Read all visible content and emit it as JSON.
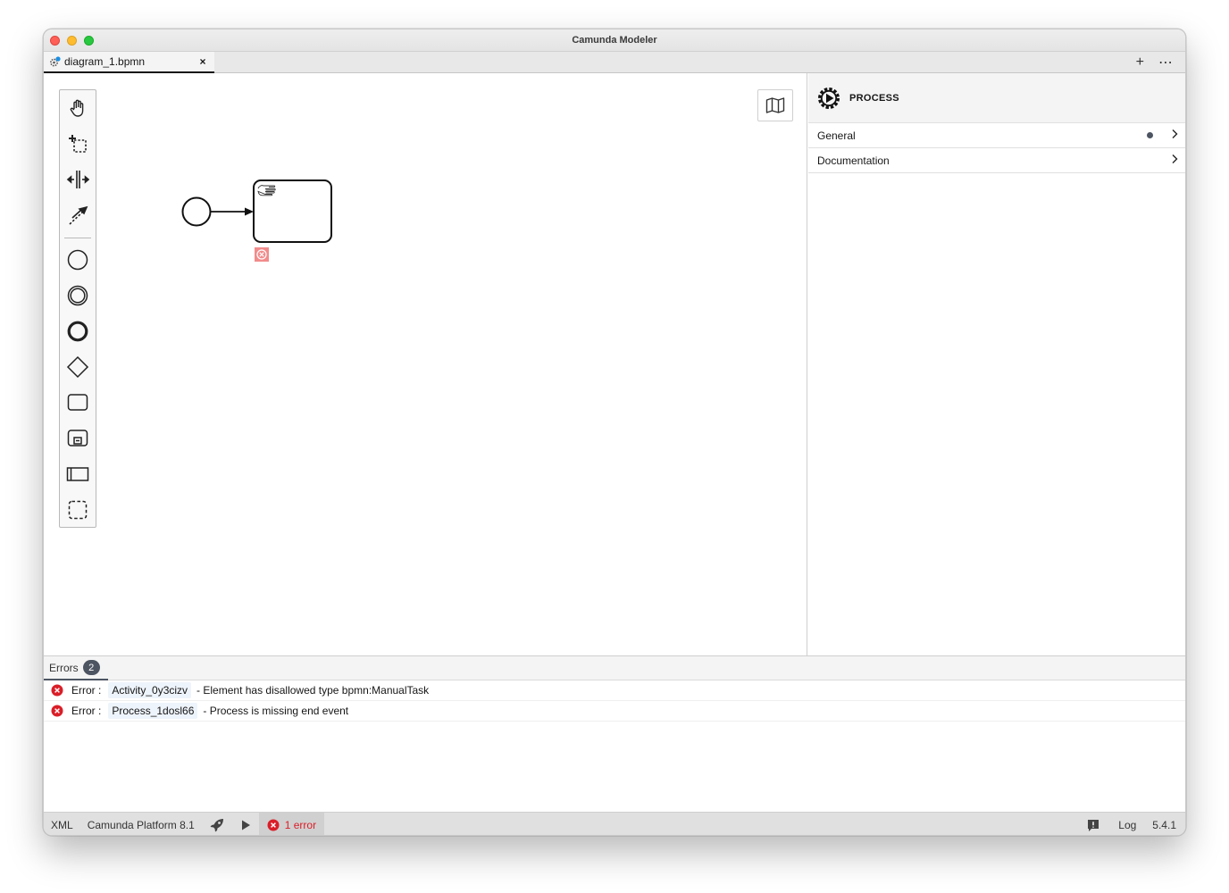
{
  "window": {
    "title": "Camunda Modeler"
  },
  "tabs": [
    {
      "label": "diagram_1.bpmn",
      "close_glyph": "×"
    }
  ],
  "tab_actions": {
    "add_glyph": "+",
    "more_glyph": "⋯"
  },
  "palette": {
    "tools": [
      "hand-tool-icon",
      "lasso-tool-icon",
      "space-tool-icon",
      "global-connect-tool-icon"
    ],
    "elements": [
      "start-event-icon",
      "intermediate-event-icon",
      "end-event-icon",
      "gateway-icon",
      "task-icon",
      "subprocess-icon",
      "pool-icon",
      "group-icon"
    ]
  },
  "properties": {
    "header_title": "PROCESS",
    "groups": [
      {
        "label": "General",
        "has_dot": true
      },
      {
        "label": "Documentation",
        "has_dot": false
      }
    ]
  },
  "errors_panel": {
    "tab_label": "Errors",
    "count": "2",
    "items": [
      {
        "kind": "Error :",
        "id": "Activity_0y3cizv",
        "message": "- Element has disallowed type bpmn:ManualTask"
      },
      {
        "kind": "Error :",
        "id": "Process_1dosl66",
        "message": "- Process is missing end event"
      }
    ]
  },
  "statusbar": {
    "xml": "XML",
    "platform": "Camunda Platform 8.1",
    "error_summary": "1 error",
    "log": "Log",
    "version": "5.4.1"
  },
  "colors": {
    "error": "#da1e28",
    "accent": "#4d5562",
    "error_marker": "#f08080"
  }
}
